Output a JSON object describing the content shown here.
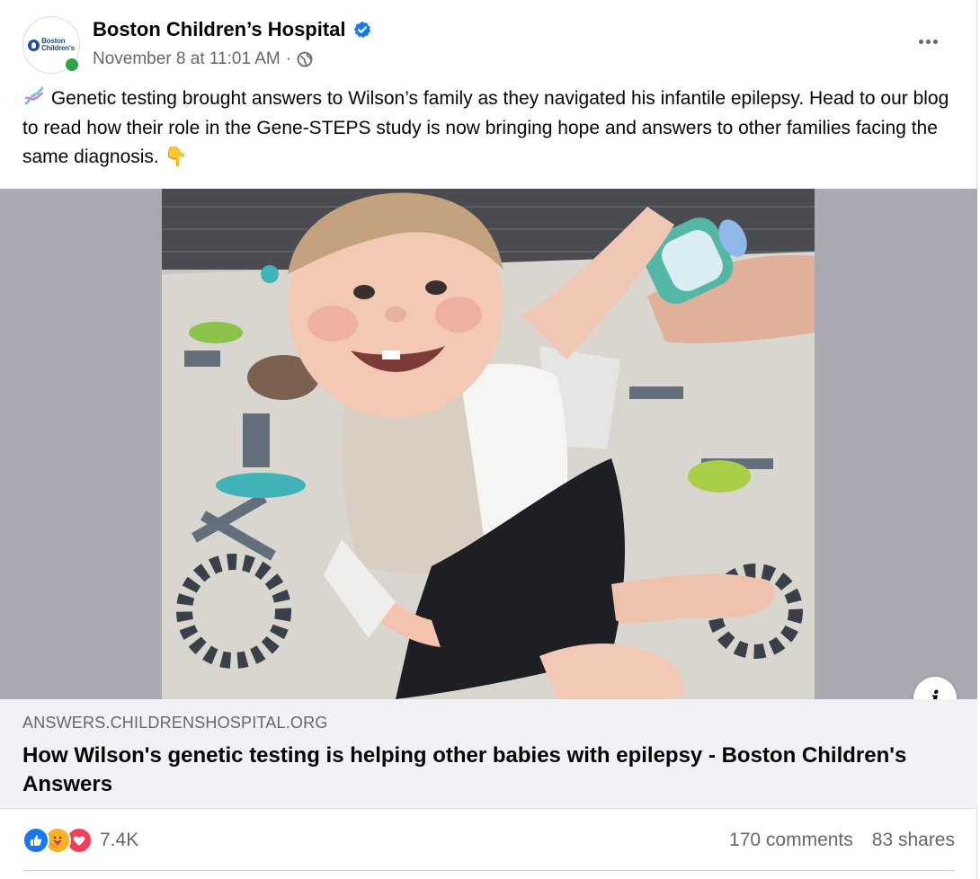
{
  "post": {
    "page_name": "Boston Children’s Hospital",
    "avatar_text_line1": "Boston",
    "avatar_text_line2": "Children's",
    "timestamp": "November 8 at 11:01 AM",
    "separator": "·",
    "caption": "Genetic testing brought answers to Wilson’s family as they navigated his infantile epilepsy. Head to our blog to read how their role in the Gene-STEPS study is now bringing hope and answers to other families facing the same diagnosis.",
    "caption_emoji_end": "👇"
  },
  "link_preview": {
    "domain": "ANSWERS.CHILDRENSHOSPITAL.ORG",
    "title": "How Wilson's genetic testing is helping other babies with epilepsy - Boston Children's Answers"
  },
  "footer": {
    "reaction_count": "7.4K",
    "comments": "170 comments",
    "shares": "83 shares"
  },
  "icons": {
    "reactions": [
      "like-icon",
      "care-icon",
      "love-icon"
    ],
    "leading_emoji": "dna-icon"
  },
  "colors": {
    "verified": "#1877f2",
    "like": "#1877f2",
    "love": "#f33e58",
    "care": "#f7b125",
    "online": "#31a24c"
  }
}
